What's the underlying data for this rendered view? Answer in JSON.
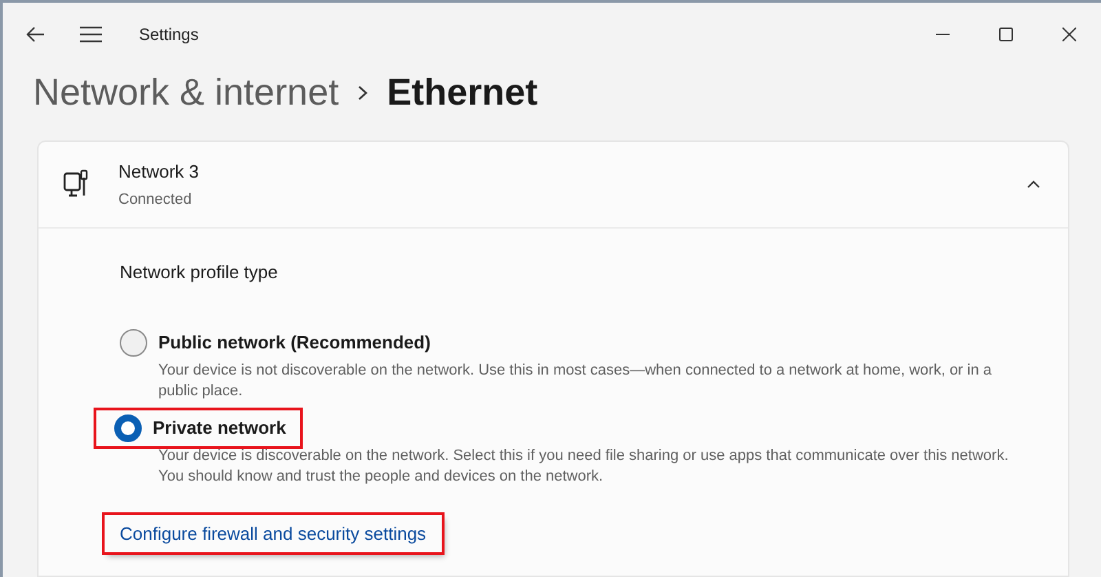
{
  "window": {
    "title": "Settings"
  },
  "breadcrumb": [
    {
      "label": "Network & internet",
      "current": false
    },
    {
      "label": "Ethernet",
      "current": true
    }
  ],
  "network": {
    "name": "Network 3",
    "status": "Connected",
    "expanded": true
  },
  "profile": {
    "heading": "Network profile type",
    "options": [
      {
        "label": "Public network (Recommended)",
        "description": "Your device is not discoverable on the network. Use this in most cases—when connected to a network at home, work, or in a public place.",
        "selected": false,
        "highlighted": false
      },
      {
        "label": "Private network",
        "description": "Your device is discoverable on the network. Select this if you need file sharing or use apps that communicate over this network. You should know and trust the people and devices on the network.",
        "selected": true,
        "highlighted": true
      }
    ]
  },
  "link": {
    "label": "Configure firewall and security settings",
    "highlighted": true
  }
}
